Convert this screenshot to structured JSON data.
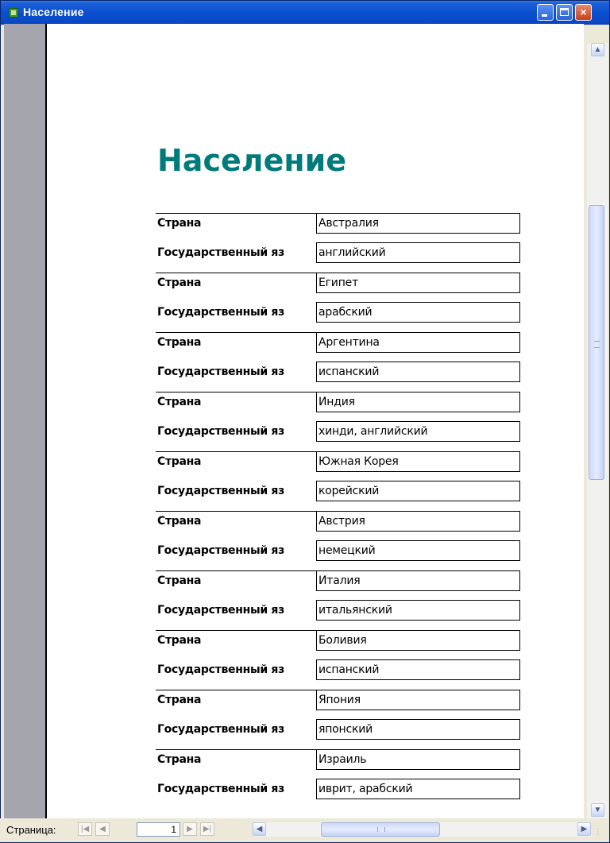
{
  "window": {
    "title": "Население",
    "controls": {
      "minimize": "minimize",
      "maximize": "maximize",
      "close": "×"
    }
  },
  "report": {
    "title": "Население",
    "country_label": "Страна",
    "language_label": "Государственный яз",
    "records": [
      {
        "country": "Австралия",
        "language": "английский"
      },
      {
        "country": "Египет",
        "language": "арабский"
      },
      {
        "country": "Аргентина",
        "language": "испанский"
      },
      {
        "country": "Индия",
        "language": "хинди, английский"
      },
      {
        "country": "Южная Корея",
        "language": "корейский"
      },
      {
        "country": "Австрия",
        "language": "немецкий"
      },
      {
        "country": "Италия",
        "language": "итальянский"
      },
      {
        "country": "Боливия",
        "language": "испанский"
      },
      {
        "country": "Япония",
        "language": "японский"
      },
      {
        "country": "Израиль",
        "language": "иврит, арабский"
      }
    ]
  },
  "statusbar": {
    "page_label": "Страница:",
    "current_page": "1",
    "nav": {
      "first": "|◀",
      "prev": "◀",
      "next": "▶",
      "last": "▶|"
    }
  },
  "scroll": {
    "up": "▲",
    "down": "▼",
    "left": "◀",
    "right": "▶",
    "grip": "⋮"
  },
  "colors": {
    "title_teal": "#007b7b",
    "titlebar_blue": "#0a4fd0",
    "gutter_gray": "#a5a5ad"
  }
}
